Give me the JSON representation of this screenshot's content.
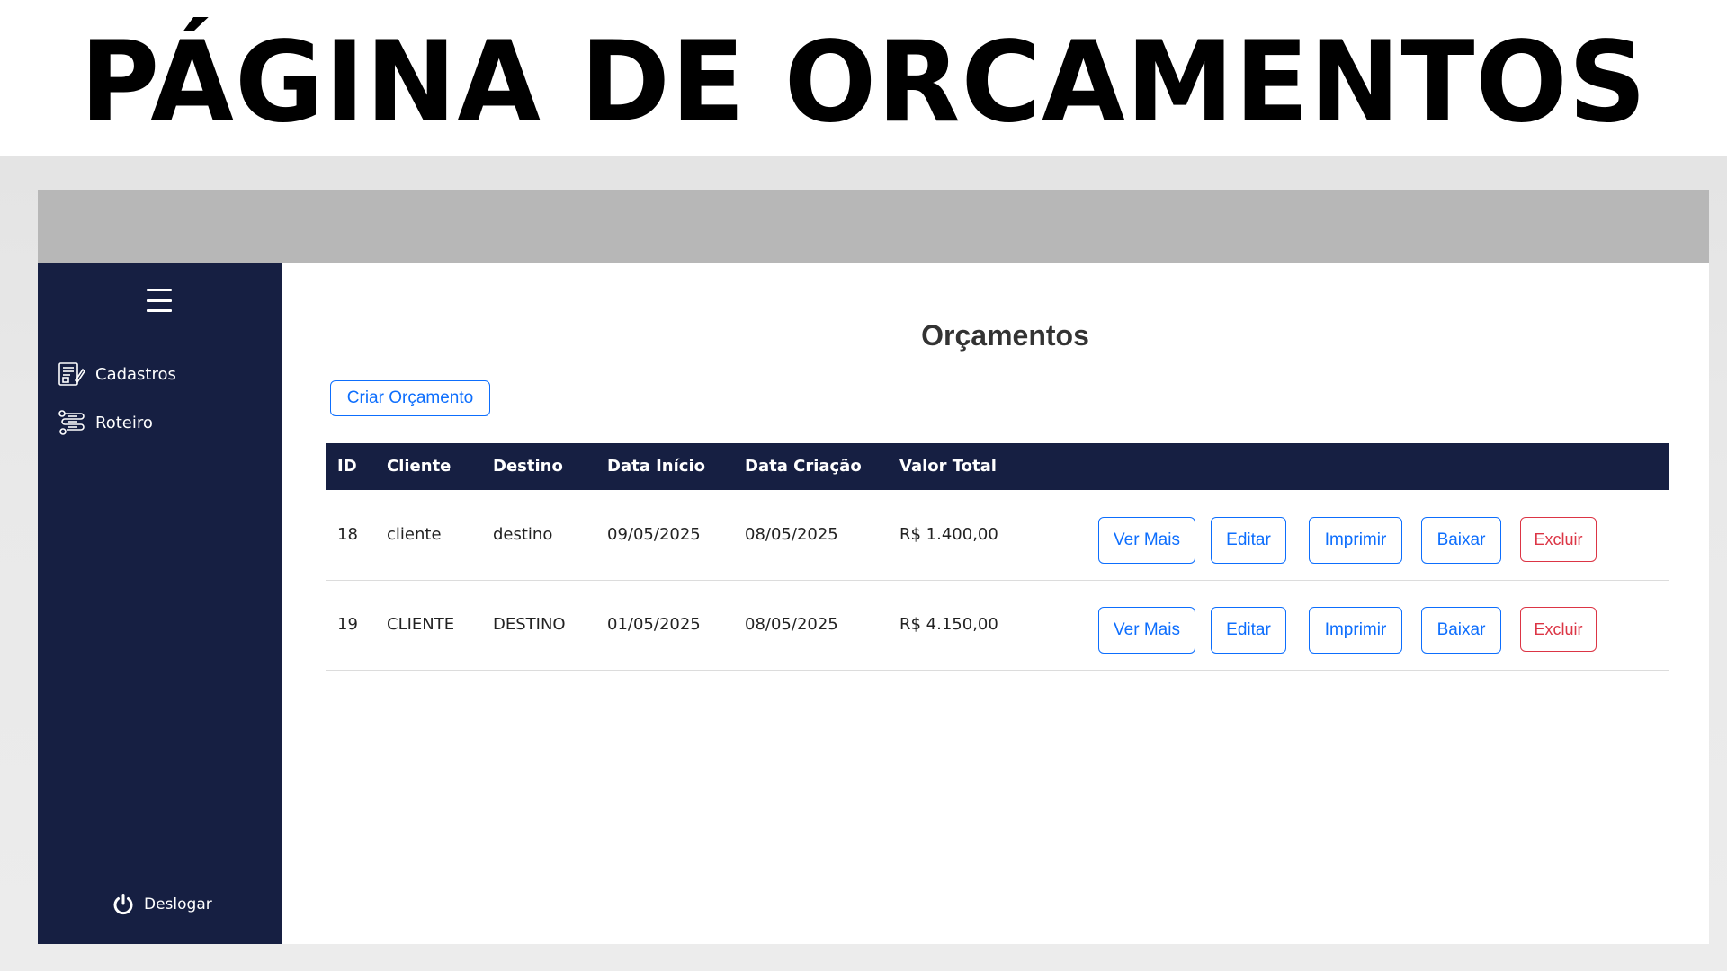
{
  "banner": {
    "title": "PÁGINA DE ORCAMENTOS"
  },
  "sidebar": {
    "menu_icon": "hamburger-menu-icon",
    "items": [
      {
        "label": "Cadastros",
        "icon": "registration-form-icon"
      },
      {
        "label": "Roteiro",
        "icon": "route-icon"
      }
    ],
    "logout": {
      "label": "Deslogar",
      "icon": "power-icon"
    }
  },
  "main": {
    "title": "Orçamentos",
    "create_button": "Criar Orçamento",
    "table": {
      "headers": [
        "ID",
        "Cliente",
        "Destino",
        "Data Início",
        "Data Criação",
        "Valor Total"
      ],
      "rows": [
        {
          "id": "18",
          "cliente": "cliente",
          "destino": "destino",
          "data_inicio": "09/05/2025",
          "data_criacao": "08/05/2025",
          "valor_total": "R$ 1.400,00"
        },
        {
          "id": "19",
          "cliente": "CLIENTE",
          "destino": "DESTINO",
          "data_inicio": "01/05/2025",
          "data_criacao": "08/05/2025",
          "valor_total": "R$ 4.150,00"
        }
      ],
      "actions": {
        "ver_mais": "Ver Mais",
        "editar": "Editar",
        "imprimir": "Imprimir",
        "baixar": "Baixar",
        "excluir": "Excluir"
      }
    }
  },
  "colors": {
    "sidebar_bg": "#161f42",
    "table_header_bg": "#161f42",
    "primary": "#0d6efd",
    "danger": "#dc3545",
    "topbar_bg": "#b7b7b7"
  }
}
